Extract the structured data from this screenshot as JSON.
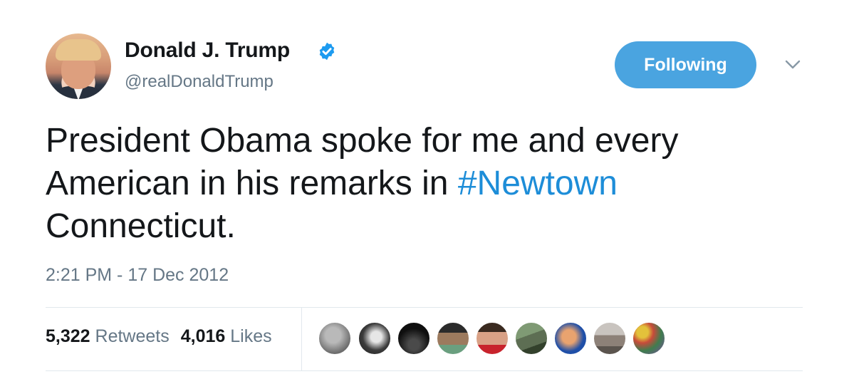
{
  "user": {
    "display_name": "Donald J. Trump",
    "handle": "@realDonaldTrump",
    "verified": true
  },
  "actions": {
    "follow_label": "Following"
  },
  "tweet": {
    "text_before": "President Obama spoke for me and every\nAmerican in his remarks in ",
    "hashtag": "#Newtown",
    "text_after": "\nConnecticut.",
    "timestamp": "2:21 PM - 17 Dec 2012"
  },
  "stats": {
    "retweets_count": "5,322",
    "retweets_label": "Retweets",
    "likes_count": "4,016",
    "likes_label": "Likes"
  },
  "colors": {
    "accent": "#4aa4e0",
    "hashtag": "#1d8dd8",
    "muted": "#657786",
    "divider": "#e1e8ed"
  }
}
